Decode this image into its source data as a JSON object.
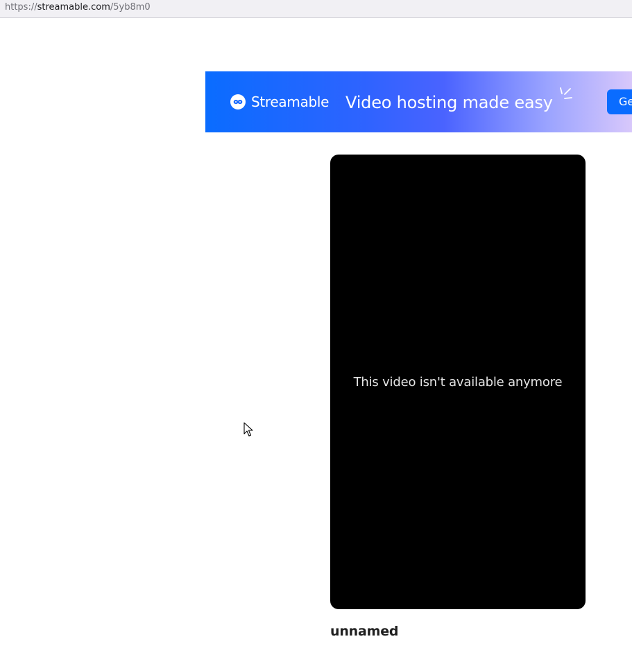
{
  "address_bar": {
    "scheme": "https://",
    "host": "streamable.com",
    "path": "/5yb8m0"
  },
  "banner": {
    "brand_name": "Streamable",
    "tagline": "Video hosting made easy",
    "cta_label": "Ge",
    "gradient_start": "#0a6cff",
    "gradient_end": "#d8c8fb",
    "logo_icon": "streamable-logo-icon",
    "sparkle_icon": "sparkle-icon"
  },
  "player": {
    "message": "This video isn't available anymore",
    "background": "#000000"
  },
  "video": {
    "title": "unnamed"
  },
  "cursor_icon": "mouse-pointer-icon"
}
